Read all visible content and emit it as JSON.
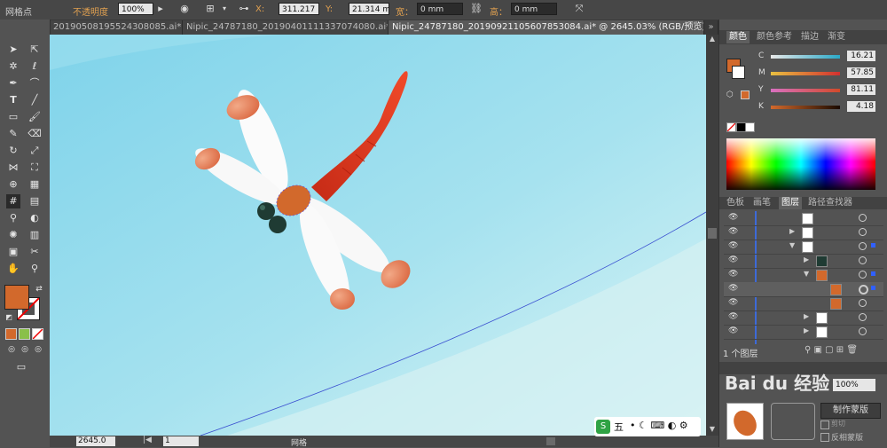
{
  "control_bar": {
    "selection_type": "网格点",
    "opacity_label": "不透明度",
    "opacity_value": "100%",
    "x_label": "X:",
    "x_value": "311.217",
    "y_label": "Y:",
    "y_value": "21.314 mm",
    "width_label": "宽：",
    "width_value": "0 mm",
    "height_label": "高：",
    "height_value": "0 mm"
  },
  "tabs": [
    {
      "label": "20190508195524308085.ai*",
      "close": "×"
    },
    {
      "label": "Nipic_24787180_20190401111337074080.ai*",
      "close": "×"
    },
    {
      "label": "Nipic_24787180_20190921105607853084.ai* @ 2645.03% (RGB/预览)",
      "close": "×"
    }
  ],
  "status_bar": {
    "zoom": "2645.0",
    "page": "1",
    "mode": "网格"
  },
  "color_panel": {
    "tabs": [
      "颜色",
      "颜色参考",
      "描边",
      "渐变"
    ],
    "channels": [
      {
        "label": "C",
        "value": "16.21"
      },
      {
        "label": "M",
        "value": "57.85"
      },
      {
        "label": "Y",
        "value": "81.11"
      },
      {
        "label": "K",
        "value": "4.18"
      }
    ],
    "fill_color": "#d2692c"
  },
  "layers_panel": {
    "tabs": [
      "色板",
      "画笔",
      "图层",
      "路径查找器"
    ],
    "footer": "1 个图层"
  },
  "bottom_panel": {
    "opacity_value": "100%",
    "make_mask_button": "制作蒙版",
    "clip_label": "剪切",
    "invert_label": "反相蒙版"
  },
  "ime": {
    "label": "五"
  },
  "watermark": "Bai du 经验",
  "colors": {
    "sky_top": "#8fd8ec",
    "sky_bottom": "#d8f3f6",
    "body_red": "#e8321e",
    "thorax": "#d2692c",
    "wing_tip": "#e0714a",
    "eye": "#1f3b33"
  }
}
